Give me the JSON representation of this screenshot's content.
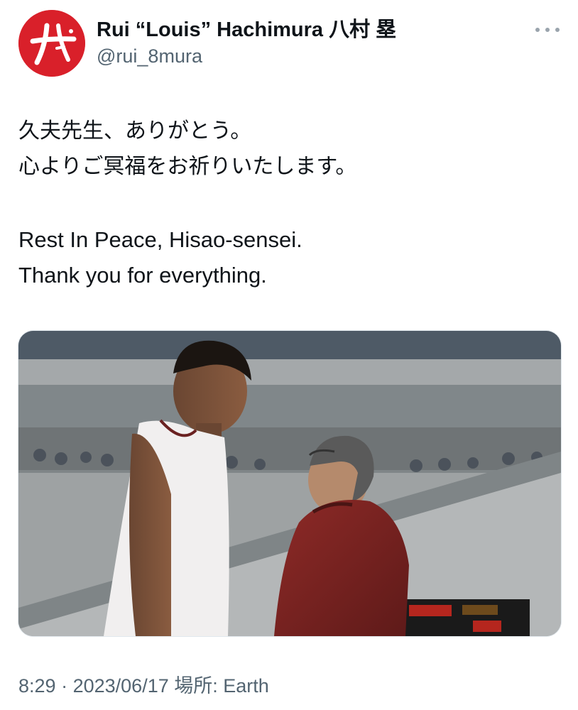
{
  "author": {
    "display_name": "Rui “Louis” Hachimura 八村 塁",
    "handle": "@rui_8mura",
    "avatar_icon": "hachimura-logo-icon",
    "avatar_color": "#d9202a"
  },
  "tweet": {
    "lines_jp": [
      "久夫先生、ありがとう。",
      "心よりご冥福をお祈りいたします。"
    ],
    "lines_en": [
      "Rest In Peace, Hisao-sensei.",
      "Thank you for everything."
    ]
  },
  "meta": {
    "time": "8:29",
    "date": "2023/06/17",
    "location_label": "場所:",
    "location": "Earth",
    "separator": "·"
  },
  "more_icon": "more-horizontal-icon",
  "colors": {
    "text": "#0f1419",
    "secondary": "#536471",
    "accent_red": "#d9202a"
  }
}
